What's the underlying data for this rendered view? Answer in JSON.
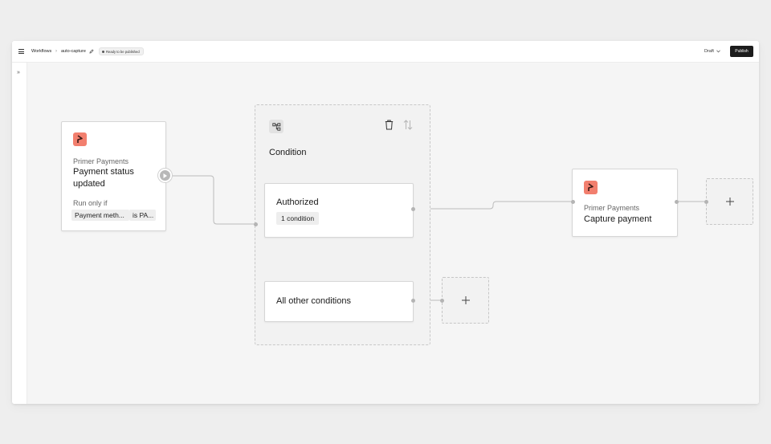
{
  "topbar": {
    "breadcrumb_root": "Workflows",
    "breadcrumb_separator": "›",
    "workflow_name": "auto-capture",
    "status_badge": "Ready to be published",
    "draft_label": "Draft",
    "publish_label": "Publish"
  },
  "trigger_node": {
    "provider": "Primer Payments",
    "title_line1": "Payment status",
    "title_line2": "updated",
    "run_only_if": "Run only if",
    "filter_field": "Payment meth...",
    "filter_value": "is PA..."
  },
  "condition_group": {
    "title": "Condition",
    "branches": [
      {
        "label": "Authorized",
        "badge": "1 condition"
      },
      {
        "label": "All other conditions"
      }
    ]
  },
  "action_node": {
    "provider": "Primer Payments",
    "title": "Capture payment"
  },
  "colors": {
    "logo": "#f27f6e",
    "publish_button": "#1c1c1c",
    "canvas": "#f5f5f5"
  },
  "icons": {
    "menu": "menu-icon",
    "edit": "pencil-icon",
    "expand": "double-chevron-right-icon",
    "branch": "branch-icon",
    "delete": "trash-icon",
    "reorder": "swap-vertical-icon",
    "add": "plus-icon",
    "run": "play-icon"
  }
}
